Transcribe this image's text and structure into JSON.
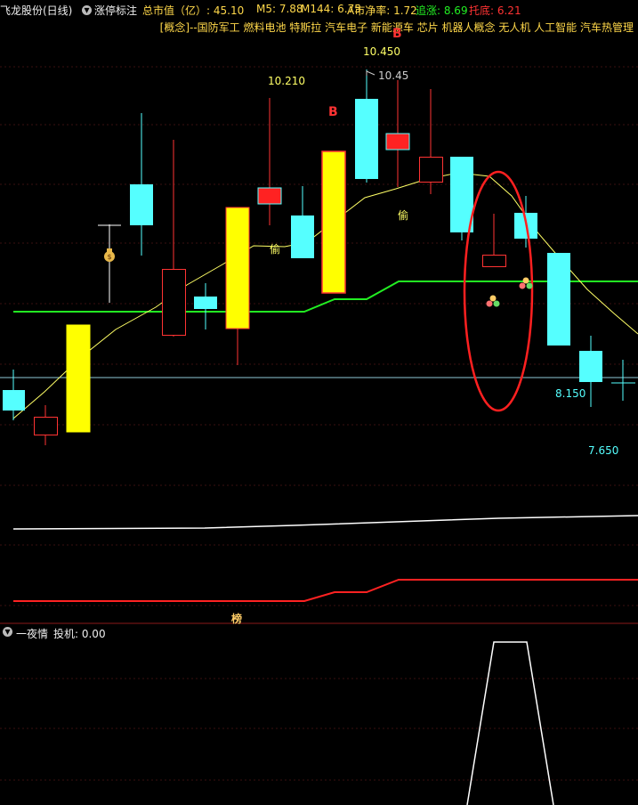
{
  "header": {
    "stock_title": "飞龙股份(日线)",
    "indicator_name": "涨停标注",
    "market_cap_label": "总市值（亿）: 45.10",
    "m5_label": "M5: 7.88",
    "m144_label": "M144: 6.75",
    "net_rate_label": "A市净率: 1.72",
    "chase_label": "追涨: 8.69",
    "support_label": "托底: 6.21",
    "concepts": "[概念]--国防军工 燃料电池 特斯拉 汽车电子 新能源车 芯片 机器人概念 无人机 人工智能 汽车热管理"
  },
  "annotations": {
    "high_1": "10.210",
    "high_2": "10.450",
    "high_marker": "10.45",
    "low_mark_1": "8.150",
    "low_mark_2": "7.650",
    "b_marker_1": "B",
    "b_marker_2": "B",
    "tou_1": "偷",
    "tou_2": "偷",
    "bang": "榜"
  },
  "sub_panel": {
    "indicator_name": "一夜情",
    "value_label": "投机: 0.00"
  },
  "colors": {
    "up_fill": "#ffff00",
    "up_cyan": "#55ffff",
    "down_red": "#ff3333",
    "ma_yellow": "#ffff66",
    "support_green": "#22ee22",
    "line_white": "#ffffff",
    "line_red": "#ff2222",
    "ellipse_red": "#ff2020"
  },
  "icons": [
    "collapse-chevron-icon",
    "money-bag-icon",
    "triple-dot-icon"
  ]
}
